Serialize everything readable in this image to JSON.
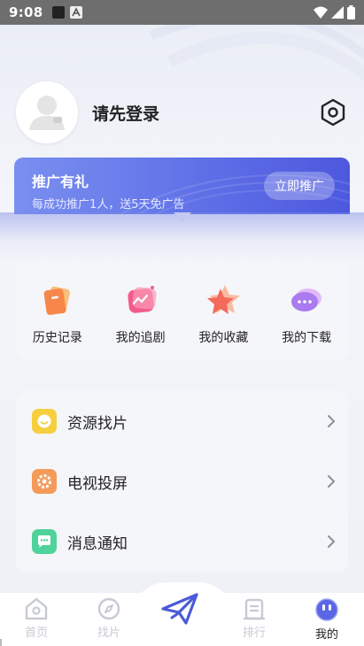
{
  "status_bar": {
    "time": "9:08"
  },
  "profile": {
    "login_prompt": "请先登录"
  },
  "promo": {
    "title": "推广有礼",
    "subtitle": "每成功推广1人，送5天免广告",
    "button": "立即推广"
  },
  "quick_menu": [
    {
      "label": "历史记录",
      "icon": "history-icon"
    },
    {
      "label": "我的追剧",
      "icon": "follow-drama-icon"
    },
    {
      "label": "我的收藏",
      "icon": "favorites-icon"
    },
    {
      "label": "我的下载",
      "icon": "download-icon"
    }
  ],
  "list_items": [
    {
      "label": "资源找片",
      "icon": "smile-face-icon",
      "color": "#f6cf3f"
    },
    {
      "label": "电视投屏",
      "icon": "gear-icon",
      "color": "#f49a5a"
    },
    {
      "label": "消息通知",
      "icon": "chat-bubble-icon",
      "color": "#4fd39a"
    }
  ],
  "bottom_nav": [
    {
      "label": "首页",
      "icon": "home-icon",
      "active": false
    },
    {
      "label": "找片",
      "icon": "compass-icon",
      "active": false
    },
    {
      "label": "",
      "icon": "paper-plane-icon",
      "active": false
    },
    {
      "label": "排行",
      "icon": "ranking-icon",
      "active": false
    },
    {
      "label": "我的",
      "icon": "profile-face-icon",
      "active": true
    }
  ],
  "colors": {
    "accent": "#5a66e4",
    "promo_gradient_start": "#7a8ff0",
    "promo_gradient_end": "#4d58df",
    "nav_inactive": "#c7cad4"
  }
}
